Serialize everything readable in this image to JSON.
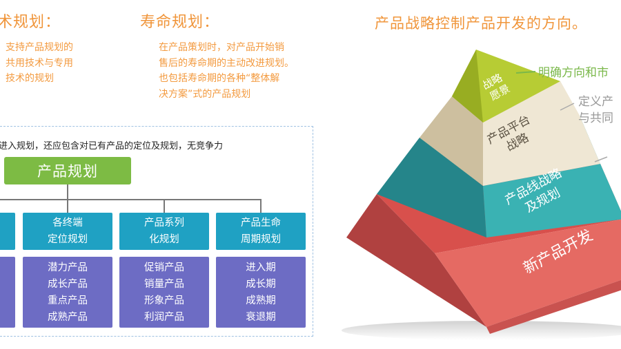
{
  "left": {
    "tech": {
      "heading": "术规划：",
      "lines": [
        "支持产品规划的",
        "共用技术与专用",
        "技术的规划"
      ]
    },
    "life": {
      "heading": "寿命规划：",
      "lines": [
        "在产品策划时，对产品开始销",
        "售后的寿命期的主动改进规划。",
        "也包括寿命期的各种“整体解",
        "决方案”式的产品规划"
      ]
    },
    "frame_note": "进入规划，还应包含对已有产品的定位及规划，无竞争力",
    "root": "产品规划",
    "categories": [
      {
        "l1": "",
        "l2": "",
        "items": []
      },
      {
        "l1": "各终端",
        "l2": "定位规划",
        "items": [
          "潜力产品",
          "成长产品",
          "重点产品",
          "成熟产品"
        ]
      },
      {
        "l1": "产品系列",
        "l2": "化规划",
        "items": [
          "促销产品",
          "销量产品",
          "形象产品",
          "利润产品"
        ]
      },
      {
        "l1": "产品生命",
        "l2": "周期规划",
        "items": [
          "进入期",
          "成长期",
          "成熟期",
          "衰退期"
        ]
      }
    ]
  },
  "right": {
    "title": "产品战略控制产品开发的方向。",
    "levels": [
      {
        "line1": "战略",
        "line2": "愿景",
        "color": "#a8c42c"
      },
      {
        "line1": "产品平台",
        "line2": "战略",
        "color": "#e8e0cc"
      },
      {
        "line1": "产品线战略",
        "line2": "及规划",
        "color": "#31a3a6"
      },
      {
        "line1": "新产品开发",
        "line2": "",
        "color": "#e0605a"
      }
    ],
    "annotations": {
      "green": "明确方向和市",
      "gray_line1": "定义产",
      "gray_line2": "与共同"
    }
  }
}
